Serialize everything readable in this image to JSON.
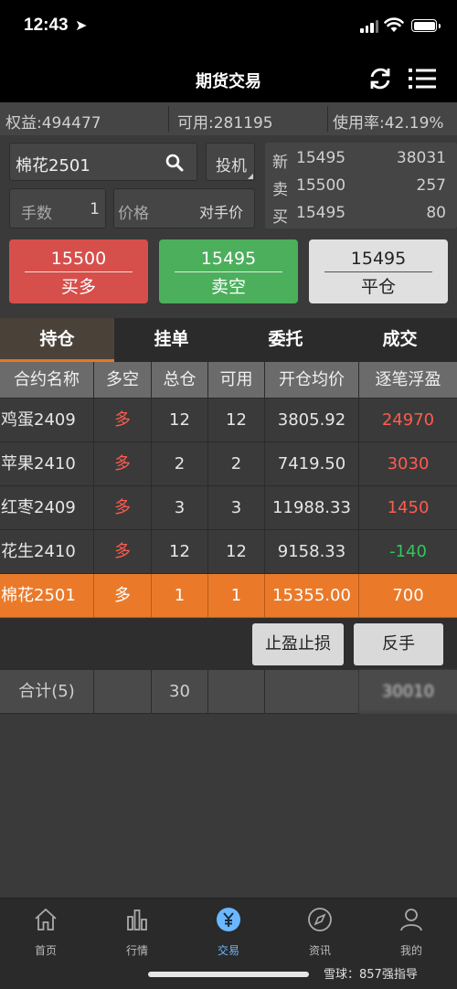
{
  "status": {
    "time": "12:43"
  },
  "nav": {
    "title": "期货交易"
  },
  "account": {
    "equity": "权益:494477",
    "available": "可用:281195",
    "usage": "使用率:42.19%"
  },
  "order": {
    "contract": "棉花2501",
    "type": "投机",
    "qty_label": "手数",
    "qty_value": "1",
    "price_label": "价格",
    "price_value": "对手价"
  },
  "quote": {
    "latest": {
      "label": "新",
      "price": "15495",
      "volume": "38031"
    },
    "ask": {
      "label": "卖",
      "price": "15500",
      "volume": "257"
    },
    "bid": {
      "label": "买",
      "price": "15495",
      "volume": "80"
    }
  },
  "buttons": {
    "buy": {
      "price": "15500",
      "label": "买多",
      "color": "#d64f4b"
    },
    "sell": {
      "price": "15495",
      "label": "卖空",
      "color": "#4caf5c"
    },
    "close": {
      "price": "15495",
      "label": "平仓",
      "color": "#e0e0e0"
    }
  },
  "tabs": [
    "持仓",
    "挂单",
    "委托",
    "成交"
  ],
  "table": {
    "headers": [
      "合约名称",
      "多空",
      "总仓",
      "可用",
      "开仓均价",
      "逐笔浮盈"
    ],
    "rows": [
      [
        "鸡蛋2409",
        "多",
        "12",
        "12",
        "3805.92",
        "24970"
      ],
      [
        "苹果2410",
        "多",
        "2",
        "2",
        "7419.50",
        "3030"
      ],
      [
        "红枣2409",
        "多",
        "3",
        "3",
        "11988.33",
        "1450"
      ],
      [
        "花生2410",
        "多",
        "12",
        "12",
        "9158.33",
        "-140"
      ],
      [
        "棉花2501",
        "多",
        "1",
        "1",
        "15355.00",
        "700"
      ]
    ]
  },
  "actions": {
    "tp_sl": "止盈止损",
    "reverse": "反手"
  },
  "totals": {
    "label": "合计(5)",
    "total": "30",
    "pnl": "30010"
  },
  "tabbar": [
    {
      "label": "首页",
      "icon": "home-icon"
    },
    {
      "label": "行情",
      "icon": "chart-icon"
    },
    {
      "label": "交易",
      "icon": "yuan-icon"
    },
    {
      "label": "资讯",
      "icon": "compass-icon"
    },
    {
      "label": "我的",
      "icon": "person-icon"
    }
  ],
  "watermark": "雪球：857强指导",
  "colors": {
    "accent": "#ea7a2a",
    "profit": "#ff5b4f",
    "loss": "#31c75a",
    "active_tab": "#6ab8ff"
  }
}
